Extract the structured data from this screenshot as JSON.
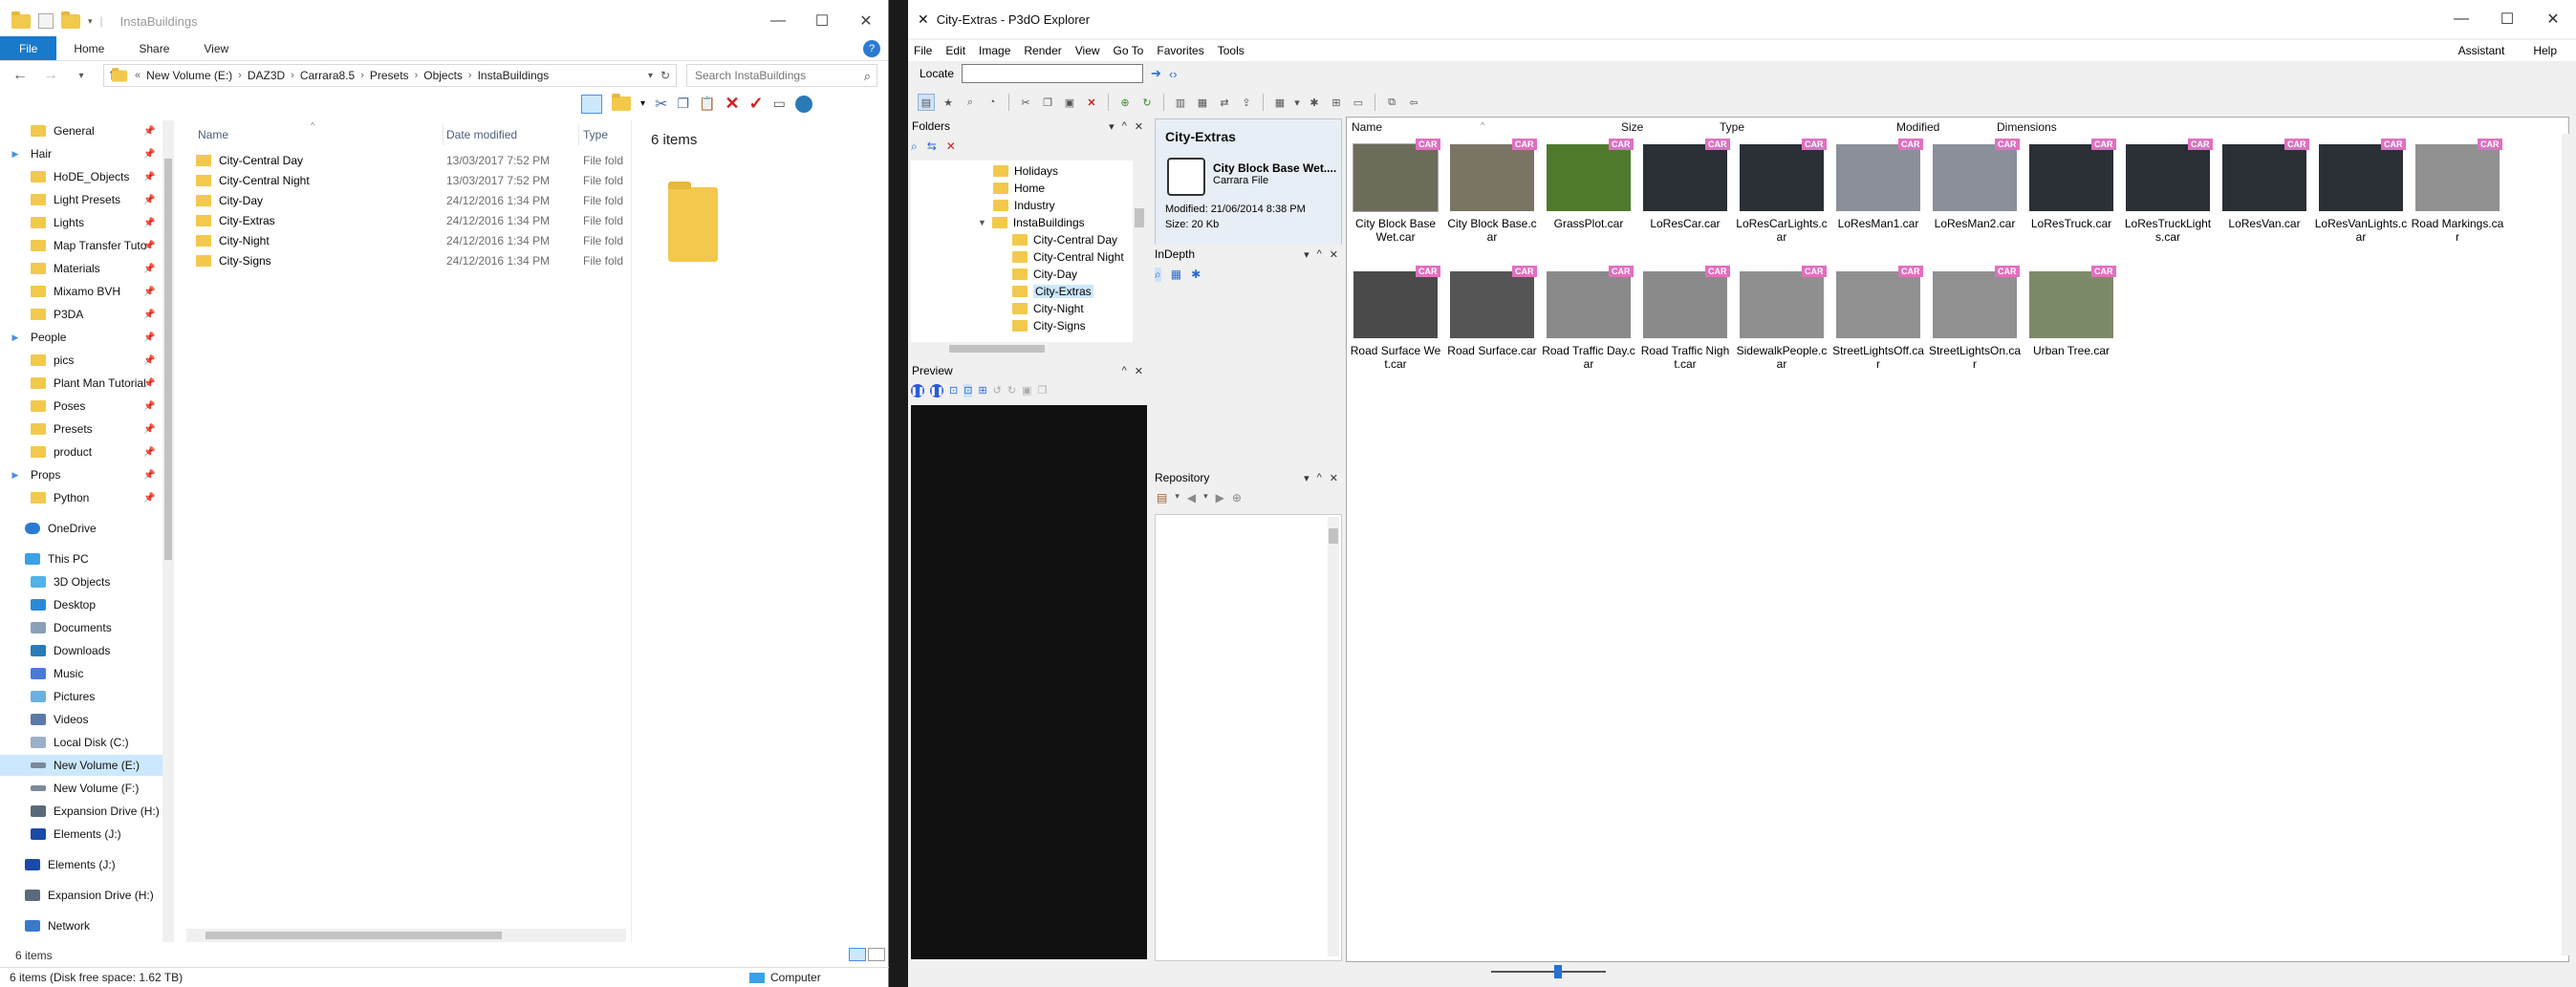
{
  "explorer": {
    "title": "InstaBuildings",
    "ribbon_tabs": [
      "File",
      "Home",
      "Share",
      "View"
    ],
    "address": [
      "New Volume (E:)",
      "DAZ3D",
      "Carrara8.5",
      "Presets",
      "Objects",
      "InstaBuildings"
    ],
    "search_placeholder": "Search InstaBuildings",
    "nav_items": [
      {
        "label": "General",
        "pinned": true
      },
      {
        "label": "Hair",
        "pinned": true,
        "expand": true
      },
      {
        "label": "HoDE_Objects",
        "pinned": true
      },
      {
        "label": "Light Presets",
        "pinned": true
      },
      {
        "label": "Lights",
        "pinned": true
      },
      {
        "label": "Map Transfer Tuto",
        "pinned": true
      },
      {
        "label": "Materials",
        "pinned": true
      },
      {
        "label": "Mixamo BVH",
        "pinned": true
      },
      {
        "label": "P3DA",
        "pinned": true
      },
      {
        "label": "People",
        "pinned": true,
        "expand": true
      },
      {
        "label": "pics",
        "pinned": true
      },
      {
        "label": "Plant Man Tutorial",
        "pinned": true
      },
      {
        "label": "Poses",
        "pinned": true
      },
      {
        "label": "Presets",
        "pinned": true
      },
      {
        "label": "product",
        "pinned": true
      },
      {
        "label": "Props",
        "pinned": true,
        "expand": true
      },
      {
        "label": "Python",
        "pinned": true
      }
    ],
    "nav_roots": [
      {
        "label": "OneDrive"
      },
      {
        "label": "This PC"
      },
      {
        "label": "3D Objects"
      },
      {
        "label": "Desktop"
      },
      {
        "label": "Documents"
      },
      {
        "label": "Downloads"
      },
      {
        "label": "Music"
      },
      {
        "label": "Pictures"
      },
      {
        "label": "Videos"
      },
      {
        "label": "Local Disk (C:)"
      },
      {
        "label": "New Volume (E:)"
      },
      {
        "label": "New Volume (F:)"
      },
      {
        "label": "Expansion Drive (H:)"
      },
      {
        "label": "Elements (J:)"
      },
      {
        "label": "Elements (J:)"
      },
      {
        "label": "Expansion Drive (H:)"
      },
      {
        "label": "Network"
      }
    ],
    "columns": [
      "Name",
      "Date modified",
      "Type"
    ],
    "files": [
      {
        "name": "City-Central Day",
        "date": "13/03/2017 7:52 PM",
        "type": "File fold"
      },
      {
        "name": "City-Central Night",
        "date": "13/03/2017 7:52 PM",
        "type": "File fold"
      },
      {
        "name": "City-Day",
        "date": "24/12/2016 1:34 PM",
        "type": "File fold"
      },
      {
        "name": "City-Extras",
        "date": "24/12/2016 1:34 PM",
        "type": "File fold"
      },
      {
        "name": "City-Night",
        "date": "24/12/2016 1:34 PM",
        "type": "File fold"
      },
      {
        "name": "City-Signs",
        "date": "24/12/2016 1:34 PM",
        "type": "File fold"
      }
    ],
    "detail_count": "6 items",
    "status_items": "6 items",
    "bottom_status": "6 items (Disk free space: 1.62 TB)",
    "bottom_computer": "Computer"
  },
  "p3do": {
    "title": "City-Extras - P3dO Explorer",
    "menu": [
      "File",
      "Edit",
      "Image",
      "Render",
      "View",
      "Go To",
      "Favorites",
      "Tools"
    ],
    "menu_right": [
      "Assistant",
      "Help"
    ],
    "locate_label": "Locate",
    "panels": {
      "folders": "Folders",
      "preview": "Preview",
      "indepth": "InDepth",
      "repository": "Repository"
    },
    "tree": [
      {
        "label": "Holidays",
        "depth": 1
      },
      {
        "label": "Home",
        "depth": 1
      },
      {
        "label": "Industry",
        "depth": 1
      },
      {
        "label": "InstaBuildings",
        "depth": 1,
        "expanded": true
      },
      {
        "label": "City-Central Day",
        "depth": 2
      },
      {
        "label": "City-Central Night",
        "depth": 2
      },
      {
        "label": "City-Day",
        "depth": 2
      },
      {
        "label": "City-Extras",
        "depth": 2,
        "selected": true
      },
      {
        "label": "City-Night",
        "depth": 2
      },
      {
        "label": "City-Signs",
        "depth": 2
      }
    ],
    "indepth": {
      "title": "City-Extras",
      "file_name": "City Block Base Wet....",
      "file_type": "Carrara File",
      "modified": "Modified: 21/06/2014 8:38 PM",
      "size": "Size: 20 Kb"
    },
    "grid_columns": [
      "Name",
      "Size",
      "Type",
      "Modified",
      "Dimensions"
    ],
    "badge": "CAR",
    "items": [
      {
        "caption": "City Block Base Wet.car",
        "color": "#6d6b5a"
      },
      {
        "caption": "City Block Base.car",
        "color": "#7a7464"
      },
      {
        "caption": "GrassPlot.car",
        "color": "#4f7a2e"
      },
      {
        "caption": "LoResCar.car",
        "color": "#2b2f36"
      },
      {
        "caption": "LoResCarLights.car",
        "color": "#2b2f36"
      },
      {
        "caption": "LoResMan1.car",
        "color": "#8a8f98"
      },
      {
        "caption": "LoResMan2.car",
        "color": "#8a8f98"
      },
      {
        "caption": "LoResTruck.car",
        "color": "#2b2f36"
      },
      {
        "caption": "LoResTruckLights.car",
        "color": "#2b2f36"
      },
      {
        "caption": "LoResVan.car",
        "color": "#2b2f36"
      },
      {
        "caption": "LoResVanLights.car",
        "color": "#2b2f36"
      },
      {
        "caption": "Road Markings.car",
        "color": "#909090"
      },
      {
        "caption": "Road Surface Wet.car",
        "color": "#4a4a4a"
      },
      {
        "caption": "Road Surface.car",
        "color": "#555555"
      },
      {
        "caption": "Road Traffic Day.car",
        "color": "#8a8a8a"
      },
      {
        "caption": "Road Traffic Night.car",
        "color": "#8a8a8a"
      },
      {
        "caption": "SidewalkPeople.car",
        "color": "#8f8f8f"
      },
      {
        "caption": "StreetLightsOff.car",
        "color": "#909090"
      },
      {
        "caption": "StreetLightsOn.car",
        "color": "#909090"
      },
      {
        "caption": "Urban Tree.car",
        "color": "#7d8a6a"
      }
    ]
  }
}
